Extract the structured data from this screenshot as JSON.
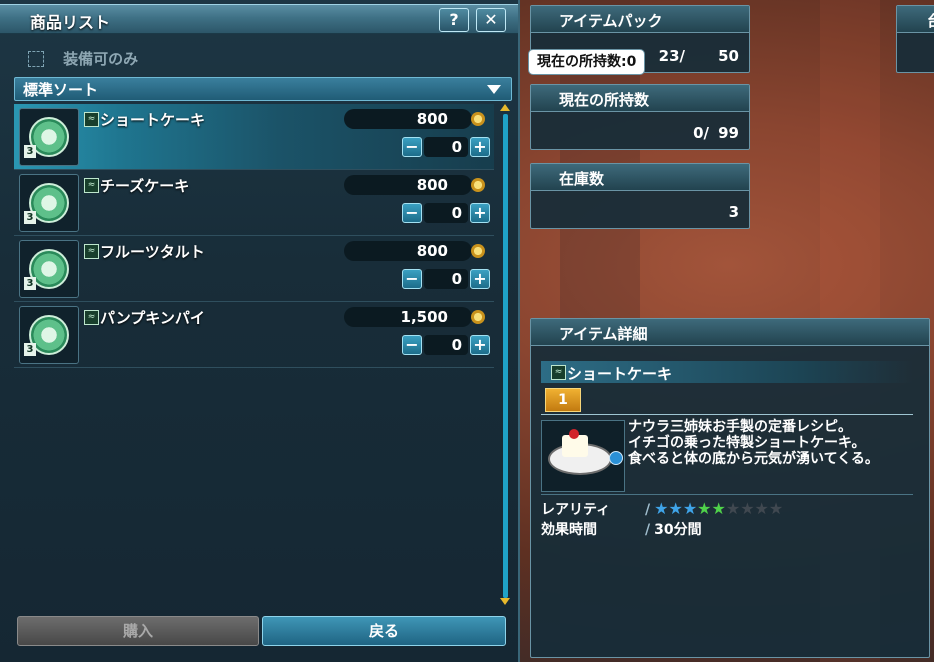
{
  "shop": {
    "title": "商品リスト",
    "help_label": "?",
    "close_label": "✕",
    "filter_label": "装備可のみ",
    "sort_label": "標準ソート",
    "items": [
      {
        "name": "ショートケーキ",
        "price": "800",
        "qty": "0",
        "icon_num": "3",
        "selected": true
      },
      {
        "name": "チーズケーキ",
        "price": "800",
        "qty": "0",
        "icon_num": "3",
        "selected": false
      },
      {
        "name": "フルーツタルト",
        "price": "800",
        "qty": "0",
        "icon_num": "3",
        "selected": false
      },
      {
        "name": "パンプキンパイ",
        "price": "1,500",
        "qty": "0",
        "icon_num": "3",
        "selected": false
      }
    ],
    "minus_label": "−",
    "plus_label": "+",
    "buy_label": "購入",
    "back_label": "戻る"
  },
  "item_pack": {
    "title": "アイテムパック",
    "current": "23/",
    "max": "50"
  },
  "held": {
    "title": "現在の所持数",
    "current": "0/",
    "max": "99"
  },
  "stock": {
    "title": "在庫数",
    "value": "3"
  },
  "tooltip": {
    "text": "現在の所持数:0"
  },
  "detail": {
    "title": "アイテム詳細",
    "name": "ショートケーキ",
    "level": "1",
    "desc_lines": [
      "ナウラ三姉妹お手製の定番レシピ。",
      "イチゴの乗った特製ショートケーキ。",
      "食べると体の底から元気が湧いてくる。"
    ],
    "rarity_label": "レアリティ",
    "rarity_stars_blue": 3,
    "rarity_stars_green": 2,
    "rarity_stars_total": 9,
    "duration_label": "効果時間",
    "duration_value": "30分間"
  },
  "colors": {
    "star_blue": "#3fa4e8",
    "star_green": "#4fd24a",
    "star_empty": "#404850"
  },
  "partial_box": {
    "title": "台"
  }
}
